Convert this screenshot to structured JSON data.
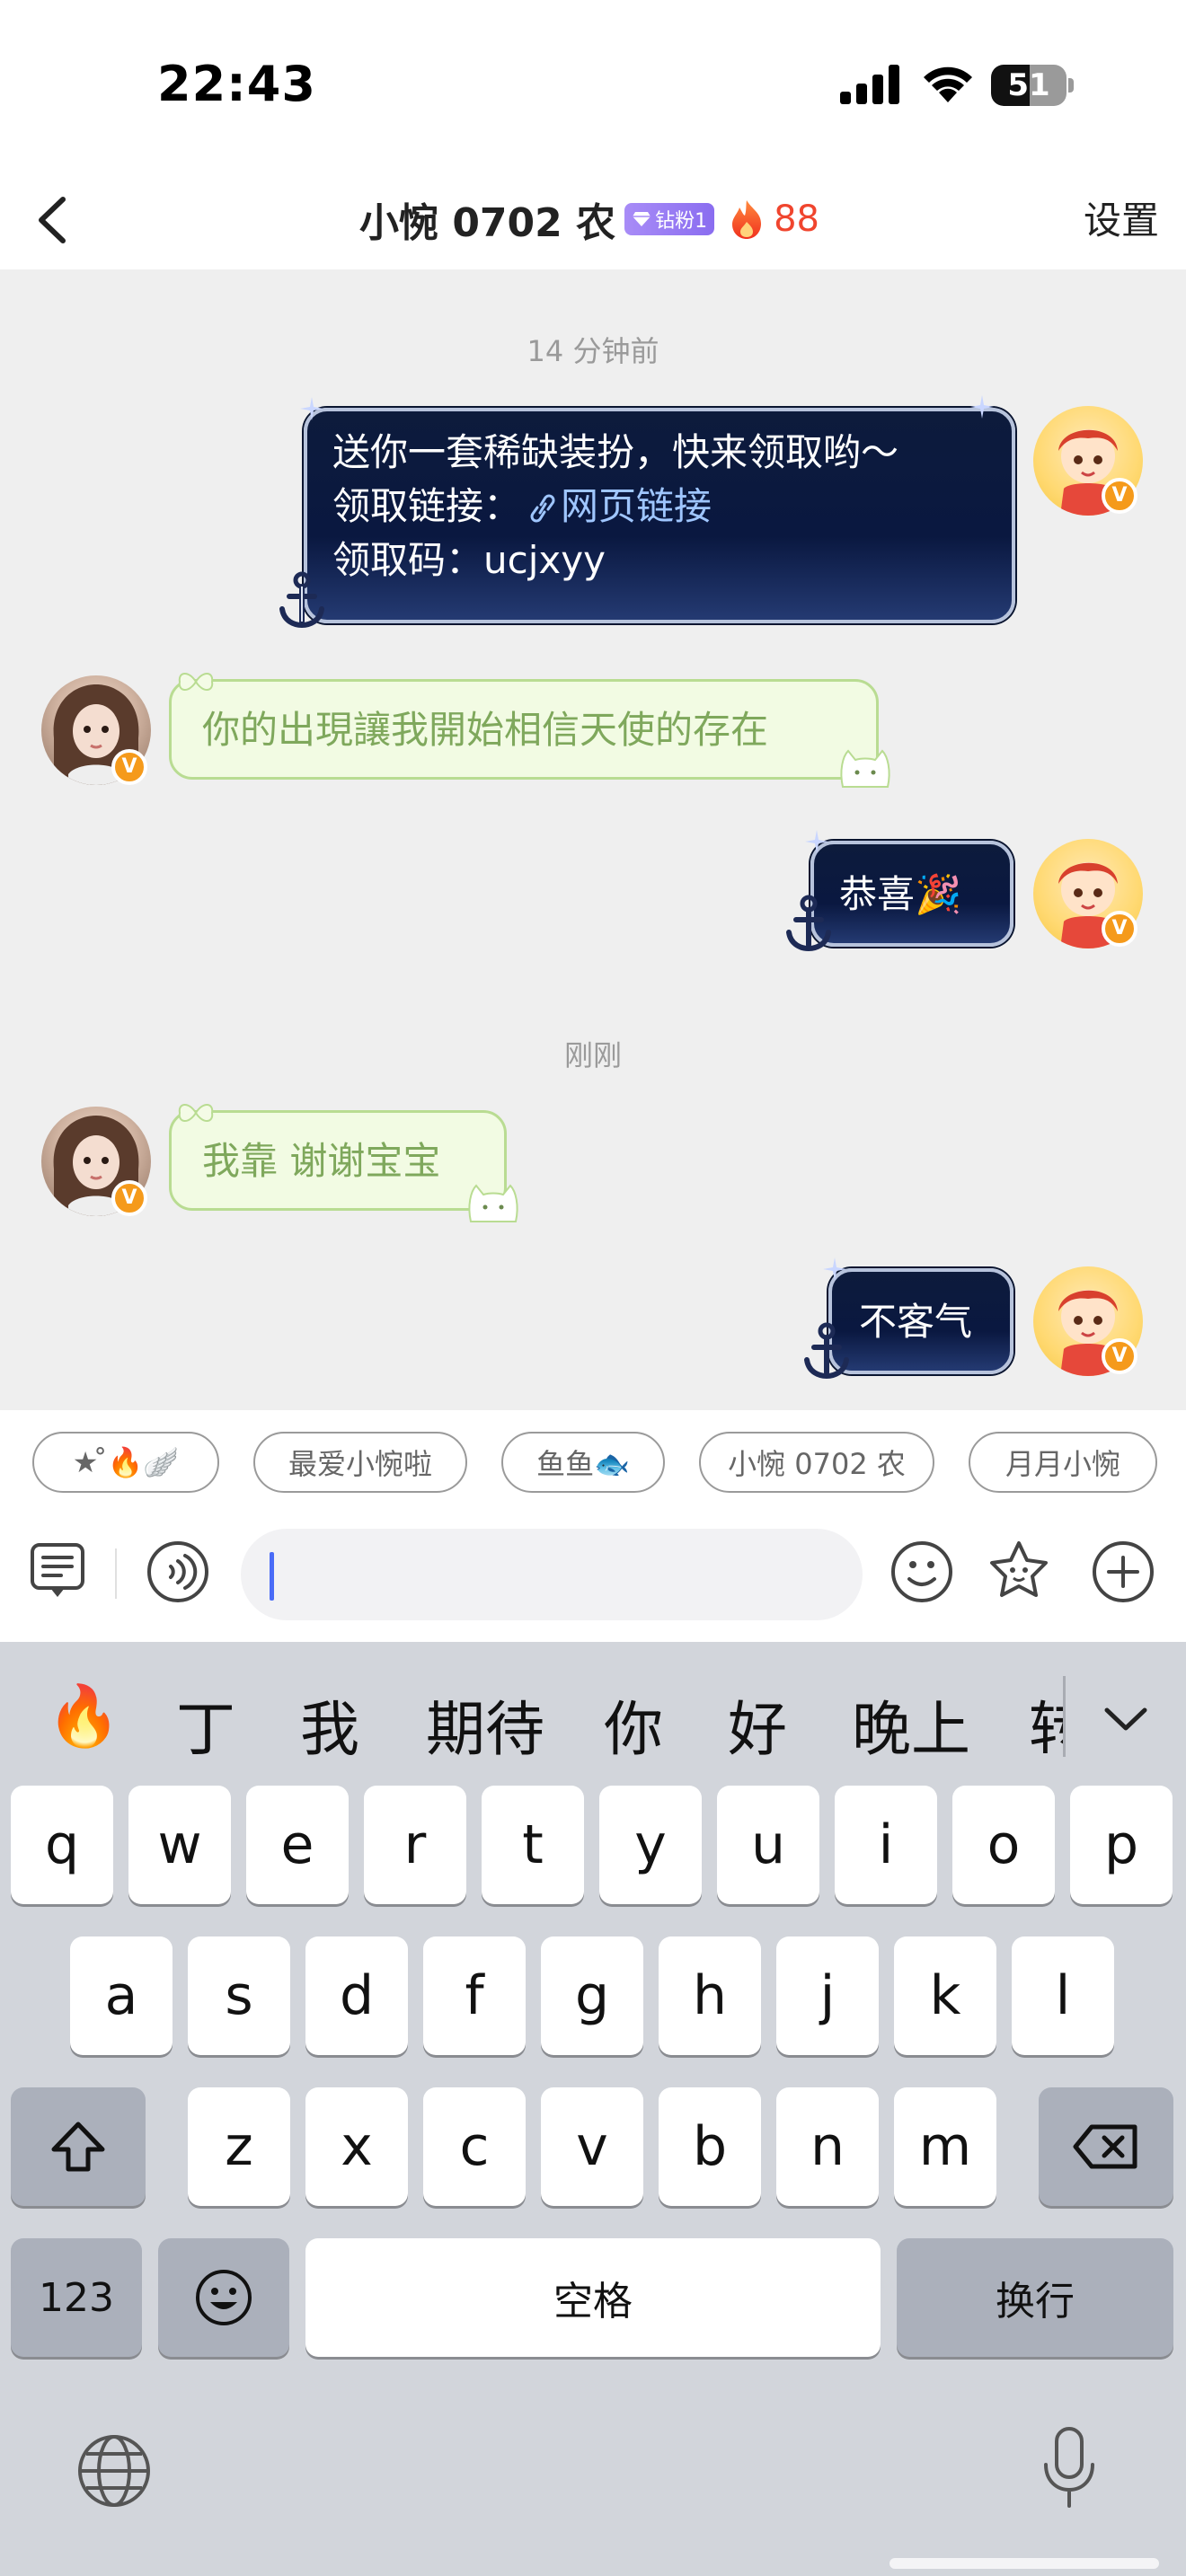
{
  "status_bar": {
    "time": "22:43",
    "battery_percent": "51",
    "battery_level": 0.51
  },
  "nav": {
    "title": "小惋 0702 农",
    "fan_badge": "钻粉1",
    "intimacy": "88",
    "settings": "设置"
  },
  "chat": {
    "time_sep_1": "14 分钟前",
    "time_sep_2": "刚刚",
    "messages": [
      {
        "from": "me",
        "line1": "送你一套稀缺装扮，快来领取哟～",
        "line2_label": "领取链接：",
        "link": "网页链接",
        "line3_label": "领取码：",
        "code": "ucjxyy"
      },
      {
        "from": "other",
        "text": "你的出現讓我開始相信天使的存在"
      },
      {
        "from": "me",
        "text": "恭喜",
        "emoji": "🎉"
      },
      {
        "from": "other",
        "text": "我靠 谢谢宝宝"
      },
      {
        "from": "me",
        "text": "不客气"
      }
    ]
  },
  "chips": [
    {
      "label": "★ ̊🔥🪽"
    },
    {
      "label": "最爱小惋啦"
    },
    {
      "label": "鱼鱼🐟"
    },
    {
      "label": "小惋 0702 农"
    },
    {
      "label": "月月小惋"
    }
  ],
  "input": {
    "value": "",
    "placeholder": ""
  },
  "keyboard": {
    "candidates": [
      "🔥",
      "丁",
      "我",
      "期待",
      "你",
      "好",
      "晚上"
    ],
    "candidate_clipped": "转",
    "row1": [
      "q",
      "w",
      "e",
      "r",
      "t",
      "y",
      "u",
      "i",
      "o",
      "p"
    ],
    "row2": [
      "a",
      "s",
      "d",
      "f",
      "g",
      "h",
      "j",
      "k",
      "l"
    ],
    "row3": [
      "z",
      "x",
      "c",
      "v",
      "b",
      "n",
      "m"
    ],
    "num_key": "123",
    "space_key": "空格",
    "return_key": "换行"
  },
  "colors": {
    "accent_link": "#9fc6ff",
    "intimacy_red": "#f0452e",
    "badge_purple": "#8a6df0",
    "cursor_blue": "#4a6cf7",
    "verified_orange": "#f59a1b"
  }
}
